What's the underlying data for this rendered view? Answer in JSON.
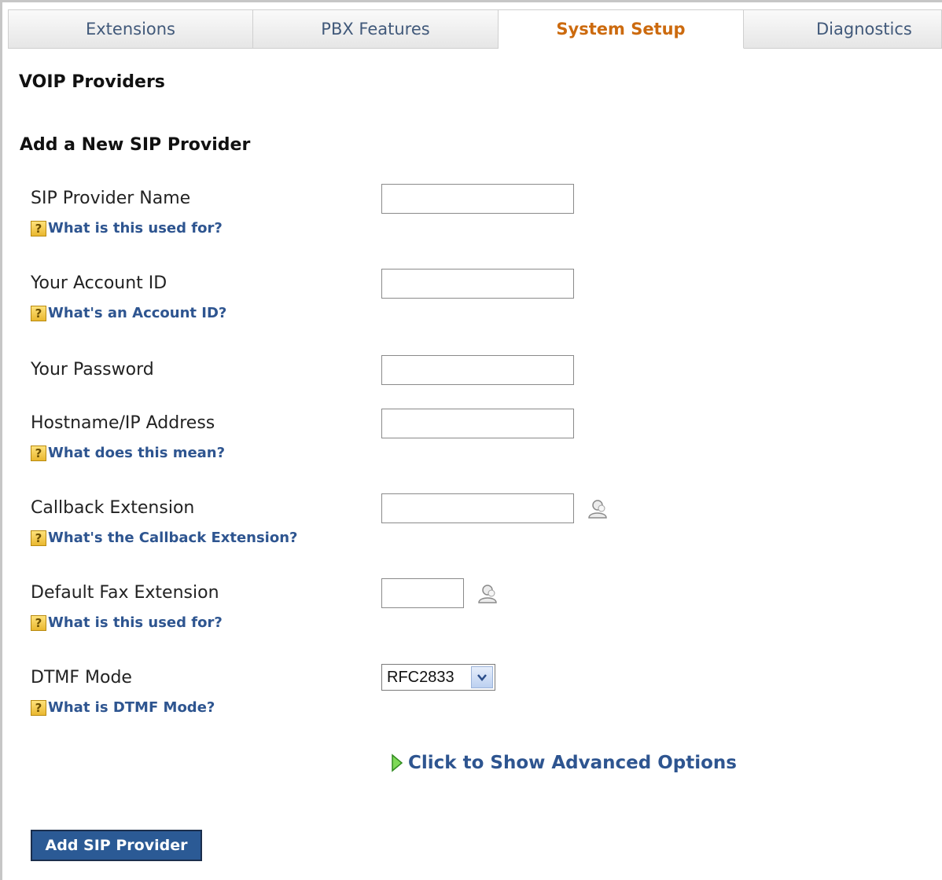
{
  "tabs": [
    {
      "label": "Extensions",
      "active": false
    },
    {
      "label": "PBX Features",
      "active": false
    },
    {
      "label": "System Setup",
      "active": true
    },
    {
      "label": "Diagnostics",
      "active": false
    }
  ],
  "page_title": "VOIP Providers",
  "section_title": "Add a New SIP Provider",
  "fields": {
    "provider_name": {
      "label": "SIP Provider Name",
      "value": "",
      "help": "What is this used for?"
    },
    "account_id": {
      "label": "Your Account ID",
      "value": "",
      "help": "What's an Account ID?"
    },
    "password": {
      "label": "Your Password",
      "value": ""
    },
    "hostname": {
      "label": "Hostname/IP Address",
      "value": "",
      "help": "What does this mean?"
    },
    "callback": {
      "label": "Callback Extension",
      "value": "",
      "help": "What's the Callback Extension?"
    },
    "fax": {
      "label": "Default Fax Extension",
      "value": "",
      "help": "What is this used for?"
    },
    "dtmf": {
      "label": "DTMF Mode",
      "value": "RFC2833",
      "help": "What is DTMF Mode?"
    }
  },
  "help_icon_glyph": "?",
  "advanced_link": "Click to Show Advanced Options",
  "submit_label": "Add SIP Provider",
  "colors": {
    "active_tab": "#cc6a0e",
    "link": "#2e5590",
    "button_bg": "#2b5a95"
  },
  "icons": {
    "help": "question-mark-icon",
    "user_picker": "user-icon",
    "advanced": "triangle-right-icon",
    "dropdown": "chevron-down-icon"
  }
}
